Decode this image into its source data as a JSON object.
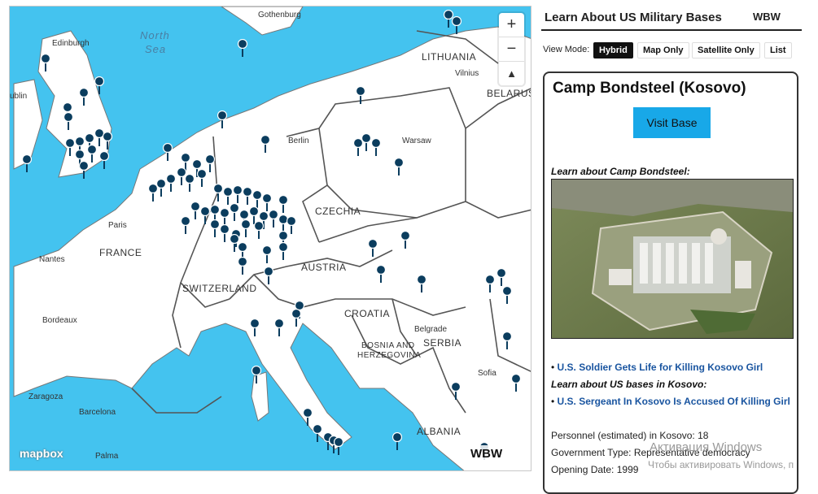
{
  "map": {
    "sea_labels": [
      "North",
      "Sea"
    ],
    "labels": [
      {
        "text": "Gothenburg",
        "kind": "city"
      },
      {
        "text": "Edinburgh",
        "kind": "city"
      },
      {
        "text": "LITHUANIA",
        "kind": "country"
      },
      {
        "text": "Vilnius",
        "kind": "city"
      },
      {
        "text": "BELARUS",
        "kind": "country"
      },
      {
        "text": "Berlin",
        "kind": "city"
      },
      {
        "text": "Warsaw",
        "kind": "city"
      },
      {
        "text": "Paris",
        "kind": "city"
      },
      {
        "text": "FRANCE",
        "kind": "country"
      },
      {
        "text": "CZECHIA",
        "kind": "country"
      },
      {
        "text": "Nantes",
        "kind": "city"
      },
      {
        "text": "AUSTRIA",
        "kind": "country"
      },
      {
        "text": "SWITZERLAND",
        "kind": "country"
      },
      {
        "text": "CROATIA",
        "kind": "country"
      },
      {
        "text": "Bordeaux",
        "kind": "city"
      },
      {
        "text": "Belgrade",
        "kind": "city"
      },
      {
        "text": "SERBIA",
        "kind": "country"
      },
      {
        "text": "BOSNIA AND",
        "kind": "country"
      },
      {
        "text": "HERZEGOVINA",
        "kind": "country"
      },
      {
        "text": "Sofia",
        "kind": "city"
      },
      {
        "text": "Zaragoza",
        "kind": "city"
      },
      {
        "text": "Barcelona",
        "kind": "city"
      },
      {
        "text": "ALBANIA",
        "kind": "country"
      },
      {
        "text": "Palma",
        "kind": "city"
      },
      {
        "text": "ublin",
        "kind": "city"
      }
    ],
    "zoom_in": "+",
    "zoom_out": "−",
    "compass": "▲",
    "attribution": "mapbox",
    "brand_logo": "WBW",
    "pin_color": "#0b3d5e",
    "water_color": "#44c3ef",
    "land_color": "#ffffff"
  },
  "panel": {
    "title": "Learn About US Military Bases",
    "logo": "WBW",
    "view_mode_label": "View Mode:",
    "view_modes": [
      "Hybrid",
      "Map Only",
      "Satellite Only",
      "List"
    ],
    "active_view_mode": "Hybrid",
    "base": {
      "name": "Camp Bondsteel (Kosovo)",
      "visit_button": "Visit Base",
      "learn_header": "Learn about Camp Bondsteel:",
      "links": [
        "U.S. Soldier Gets Life for Killing Kosovo Girl",
        "U.S. Sergeant In Kosovo Is Accused Of Killing Girl"
      ],
      "bases_in_country": "Learn about US bases in Kosovo:",
      "facts": [
        "Personnel (estimated) in Kosovo: 18",
        "Government Type: Representative democracy",
        "Opening Date: 1999"
      ]
    }
  },
  "overlay": {
    "activation_title": "Активация Windows",
    "activation_sub": "Чтобы активировать Windows, п"
  }
}
